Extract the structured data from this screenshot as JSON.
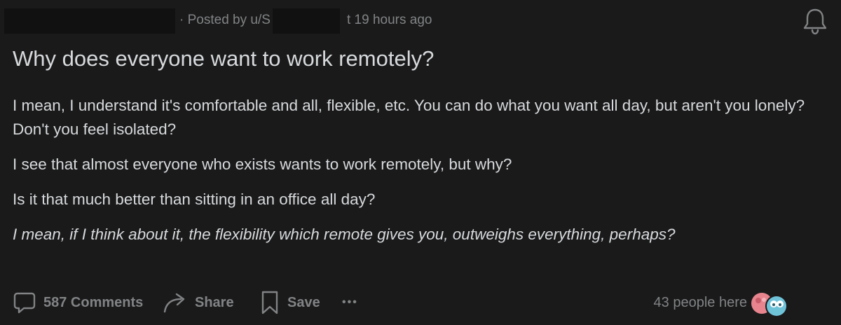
{
  "meta": {
    "posted_by_prefix": "· Posted by u/S",
    "time_suffix": "t 19 hours ago"
  },
  "post": {
    "title": "Why does everyone want to work remotely?",
    "paragraphs": [
      "I mean, I understand it's comfortable and all, flexible, etc. You can do what you want all day, but aren't you lonely? Don't you feel isolated?",
      "I see that almost everyone who exists wants to work remotely, but why?",
      "Is it that much better than sitting in an office all day?"
    ],
    "italic_paragraph": "I mean, if I think about it, the flexibility which remote gives you, outweighs everything, perhaps?"
  },
  "actions": {
    "comments_label": "587 Comments",
    "share_label": "Share",
    "save_label": "Save",
    "more_label": "•••"
  },
  "presence": {
    "text": "43 people here"
  },
  "colors": {
    "background": "#1a1a1b",
    "text_primary": "#d7dadc",
    "text_muted": "#818384",
    "avatar_pink": "#e8848e",
    "avatar_blue": "#6fc3d9"
  },
  "icons": {
    "notification": "bell-icon",
    "comments": "speech-bubble-icon",
    "share": "share-arrow-icon",
    "save": "bookmark-icon",
    "more": "ellipsis-icon"
  }
}
